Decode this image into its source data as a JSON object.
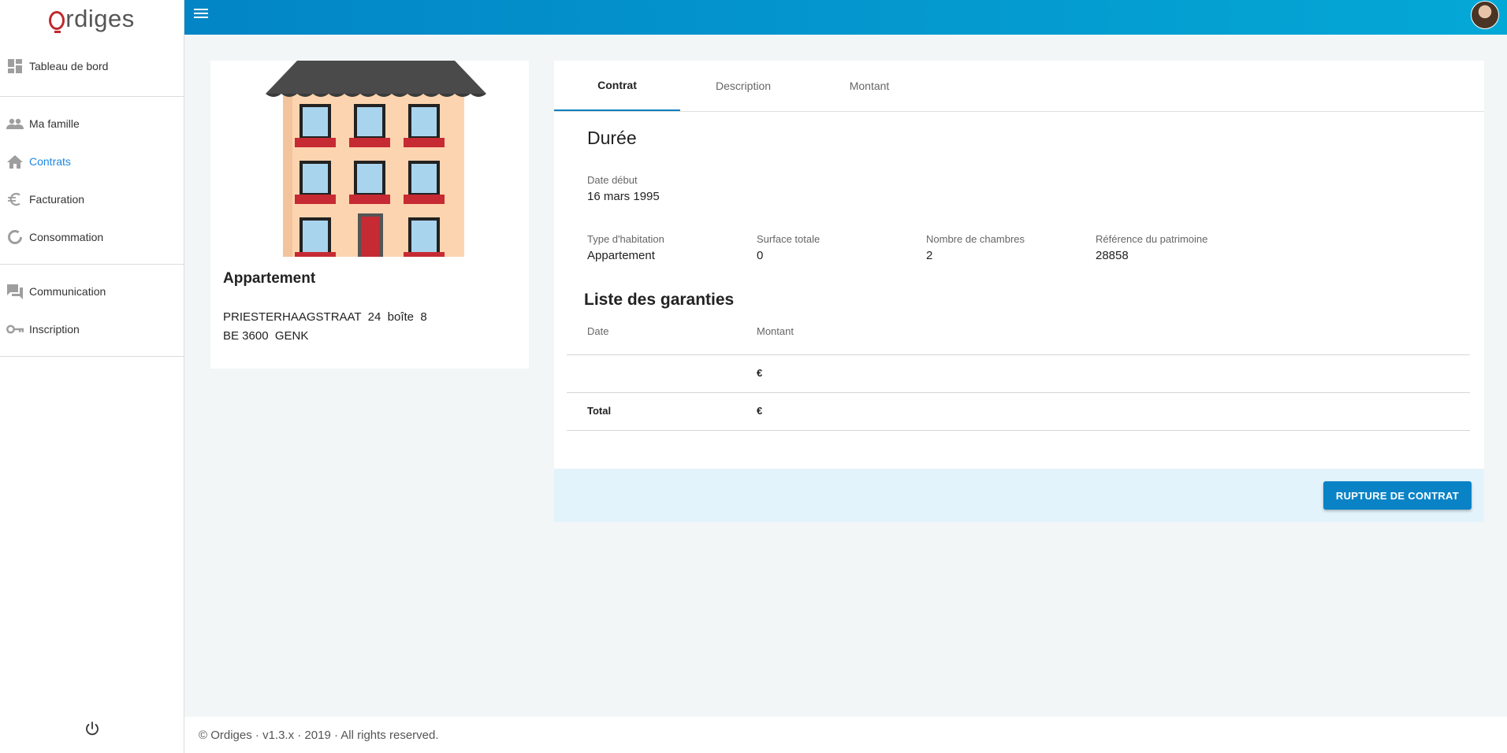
{
  "app": {
    "logo_rest": "rdiges"
  },
  "sidebar": {
    "items": [
      {
        "label": "Tableau de bord",
        "icon": "dashboard-icon"
      },
      {
        "label": "Ma famille",
        "icon": "people-icon"
      },
      {
        "label": "Contrats",
        "icon": "home-icon",
        "active": true
      },
      {
        "label": "Facturation",
        "icon": "euro-icon"
      },
      {
        "label": "Consommation",
        "icon": "donut-icon"
      },
      {
        "label": "Communication",
        "icon": "chat-icon"
      },
      {
        "label": "Inscription",
        "icon": "key-icon"
      }
    ]
  },
  "property": {
    "type_title": "Appartement",
    "address_line1": "PRIESTERHAAGSTRAAT  24  boîte  8",
    "address_line2": "BE 3600  GENK"
  },
  "tabs": [
    {
      "label": "Contrat",
      "active": true
    },
    {
      "label": "Description"
    },
    {
      "label": "Montant"
    }
  ],
  "duree": {
    "title": "Durée",
    "date_debut_label": "Date début",
    "date_debut_value": "16 mars 1995"
  },
  "details": {
    "type_label": "Type d'habitation",
    "type_value": "Appartement",
    "surface_label": "Surface totale",
    "surface_value": "0",
    "chambres_label": "Nombre de chambres",
    "chambres_value": "2",
    "ref_label": "Référence du patrimoine",
    "ref_value": "28858"
  },
  "garanties": {
    "title": "Liste des garanties",
    "col_date": "Date",
    "col_montant": "Montant",
    "rows": [
      {
        "date": "",
        "montant": "€"
      }
    ],
    "total_label": "Total",
    "total_value": "€"
  },
  "actions": {
    "rupture_label": "RUPTURE DE CONTRAT"
  },
  "footer": {
    "text": "© Ordiges · v1.3.x · 2019 · All rights reserved."
  },
  "colors": {
    "topbar_start": "#0385c6",
    "topbar_end": "#04a8d6",
    "accent": "#1e88e5",
    "logo_red": "#c0282d",
    "button": "#0a83c6"
  }
}
